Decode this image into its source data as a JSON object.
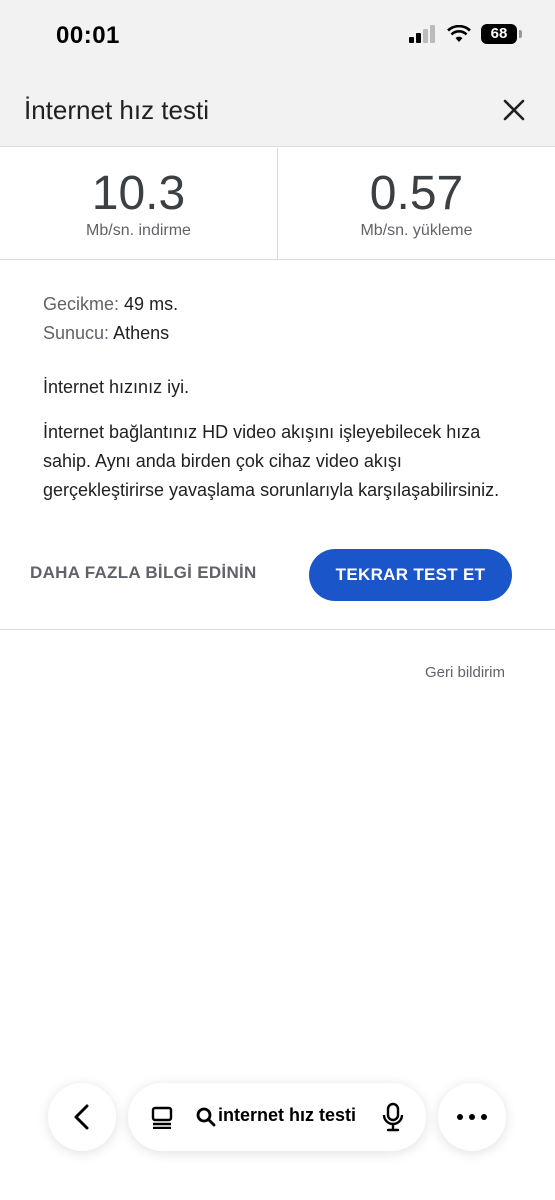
{
  "status_bar": {
    "time": "00:01",
    "battery": "68"
  },
  "header": {
    "title": "İnternet hız testi"
  },
  "speeds": {
    "download": {
      "value": "10.3",
      "unit": "Mb/sn. indirme"
    },
    "upload": {
      "value": "0.57",
      "unit": "Mb/sn. yükleme"
    }
  },
  "details": {
    "latency_label": "Gecikme:",
    "latency_value": "49 ms.",
    "server_label": "Sunucu:",
    "server_value": "Athens",
    "verdict": "İnternet hızınız iyi.",
    "description": "İnternet bağlantınız HD video akışını işleyebilecek hıza sahip. Aynı anda birden çok cihaz video akışı gerçekleştirirse yavaşlama sorunlarıyla karşılaşabilirsiniz."
  },
  "actions": {
    "more_info": "DAHA FAZLA BİLGİ EDİNİN",
    "retest": "TEKRAR TEST ET"
  },
  "feedback": "Geri bildirim",
  "bottom_bar": {
    "search_query": "internet hız testi"
  },
  "colors": {
    "accent": "#1a56c9",
    "header_bg": "#f2f2f2"
  }
}
